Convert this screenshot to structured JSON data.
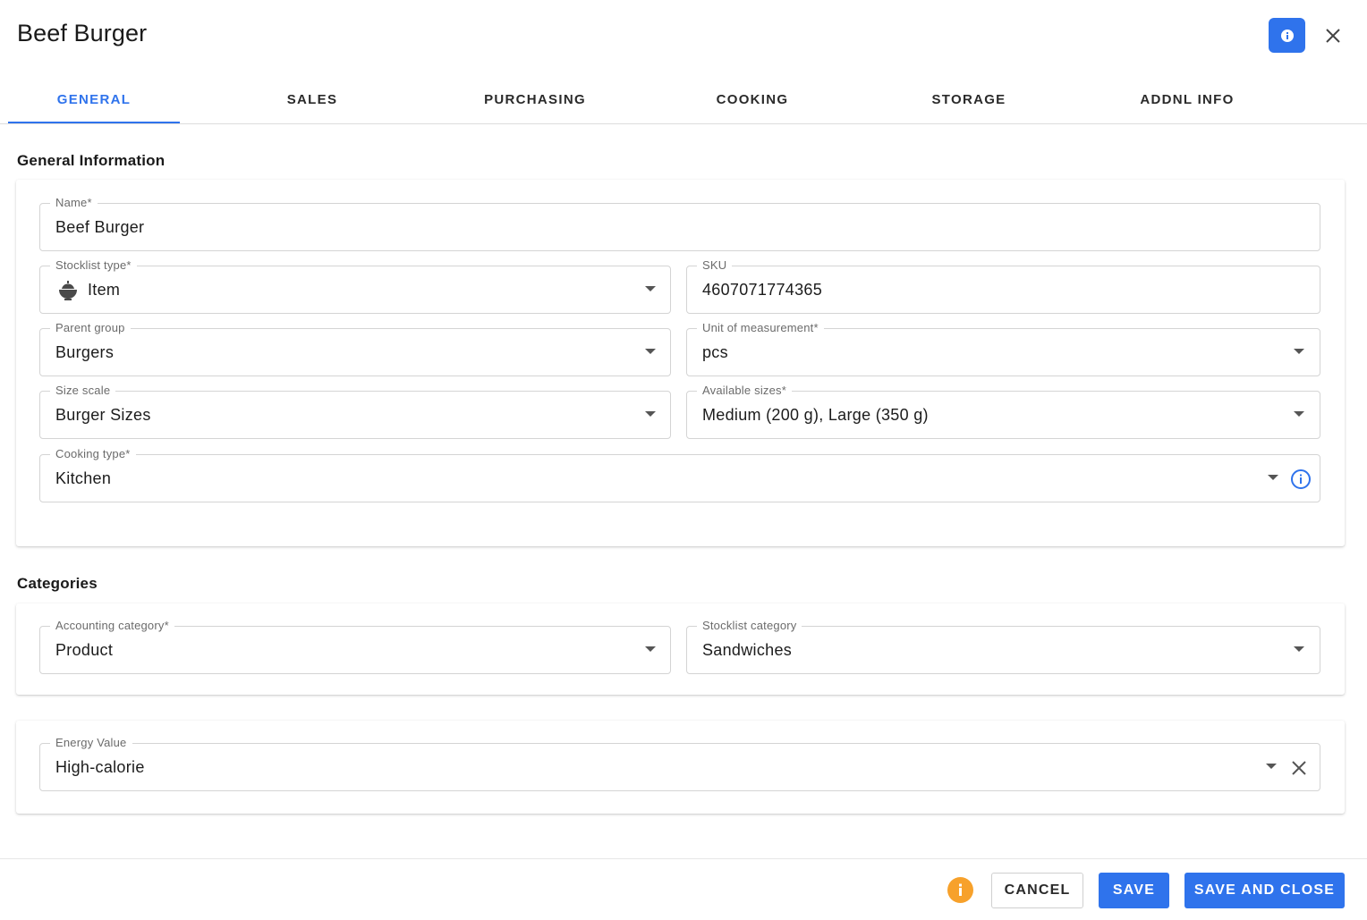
{
  "dialog": {
    "title": "Beef Burger"
  },
  "tabs": [
    {
      "label": "GENERAL",
      "active": true
    },
    {
      "label": "SALES",
      "active": false
    },
    {
      "label": "PURCHASING",
      "active": false
    },
    {
      "label": "COOKING",
      "active": false
    },
    {
      "label": "STORAGE",
      "active": false
    },
    {
      "label": "ADDNL INFO",
      "active": false
    }
  ],
  "general": {
    "section_title": "General Information",
    "name": {
      "label": "Name*",
      "value": "Beef Burger"
    },
    "stocklist_type": {
      "label": "Stocklist type*",
      "value": "Item",
      "icon": "bowl-icon"
    },
    "sku": {
      "label": "SKU",
      "value": "4607071774365"
    },
    "parent_group": {
      "label": "Parent group",
      "value": "Burgers"
    },
    "unit": {
      "label": "Unit of measurement*",
      "value": "pcs"
    },
    "size_scale": {
      "label": "Size scale",
      "value": "Burger Sizes"
    },
    "available_sizes": {
      "label": "Available sizes*",
      "value": "Medium (200 g), Large (350 g)"
    },
    "cooking_type": {
      "label": "Cooking type*",
      "value": "Kitchen"
    }
  },
  "categories": {
    "section_title": "Categories",
    "accounting": {
      "label": "Accounting category*",
      "value": "Product"
    },
    "stocklist": {
      "label": "Stocklist category",
      "value": "Sandwiches"
    }
  },
  "energy": {
    "label": "Energy Value",
    "value": "High-calorie"
  },
  "footer": {
    "cancel": "CANCEL",
    "save": "SAVE",
    "save_close": "SAVE AND CLOSE"
  },
  "colors": {
    "accent": "#2f73ec",
    "warning": "#f7a12b"
  }
}
